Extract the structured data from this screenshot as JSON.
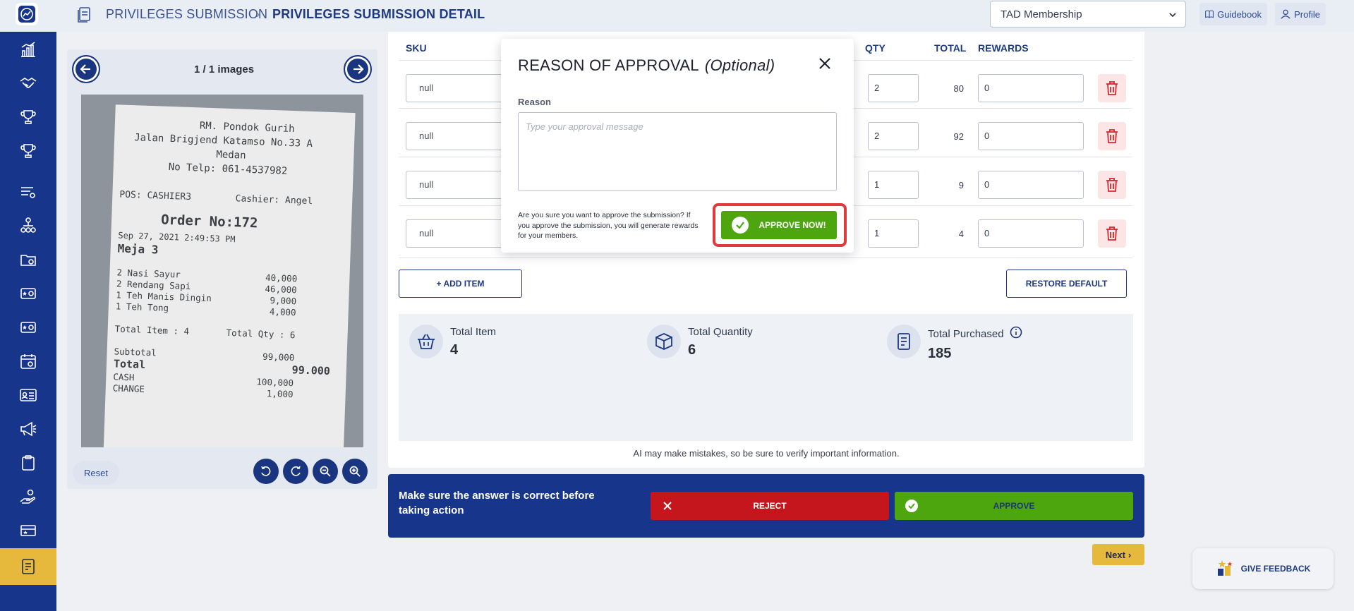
{
  "header": {
    "breadcrumb_parent": "PRIVILEGES SUBMISSION",
    "breadcrumb_current": "PRIVILEGES SUBMISSION DETAIL",
    "program_select_value": "TAD Membership",
    "guidebook_label": "Guidebook",
    "profile_label": "Profile"
  },
  "sidebar": {
    "icons": [
      "chart-icon",
      "handshake-icon",
      "trophy-icon",
      "trophy-icon",
      "list-filter-icon",
      "org-chart-icon",
      "folder-icon",
      "star-card-icon",
      "star-card-icon",
      "calendar-icon",
      "id-card-icon",
      "megaphone-icon",
      "clipboard-icon",
      "hand-coin-icon",
      "ticket-icon",
      "document-icon"
    ],
    "active_index": 15
  },
  "viewer": {
    "image_counter": "1 / 1 images",
    "reset_label": "Reset",
    "receipt_lines": [
      "RM. Pondok Gurih",
      "Jalan Brigjend Katamso No.33 A",
      "Medan",
      "No Telp: 061-4537982",
      "POS: CASHIER3        Cashier: Angel",
      "Order No:172",
      "Sep 27, 2021 2:49:53 PM",
      "Meja 3",
      "2 Nasi Sayur                40,000",
      "2 Rendang Sapi              46,000",
      "1 Teh Manis Dingin           9,000",
      "1 Teh Tong                   4,000",
      "Total Item : 4       Total Qty : 6",
      "Subtotal                    99,000",
      "Total                       99.000",
      "CASH                       100,000",
      "CHANGE                       1,000"
    ]
  },
  "table": {
    "headers": {
      "sku": "SKU",
      "qty": "QTY",
      "total": "TOTAL",
      "rewards": "REWARDS"
    },
    "rows": [
      {
        "sku": "null",
        "qty": "2",
        "total": "80",
        "reward": "0"
      },
      {
        "sku": "null",
        "qty": "2",
        "total": "92",
        "reward": "0"
      },
      {
        "sku": "null",
        "qty": "1",
        "total": "9",
        "reward": "0"
      },
      {
        "sku": "null",
        "qty": "1",
        "total": "4",
        "reward": "0"
      }
    ],
    "add_item_label": "+ ADD ITEM",
    "restore_default_label": "RESTORE DEFAULT"
  },
  "summary": {
    "total_item_label": "Total Item",
    "total_item_value": "4",
    "total_quantity_label": "Total Quantity",
    "total_quantity_value": "6",
    "total_purchased_label": "Total Purchased",
    "total_purchased_value": "185"
  },
  "ai_note": "AI may make mistakes, so be sure to verify important information.",
  "action_bar": {
    "message": "Make sure the answer is correct before taking action",
    "reject_label": "REJECT",
    "approve_label": "APPROVE"
  },
  "next_label": "Next",
  "feedback_label": "GIVE FEEDBACK",
  "modal": {
    "title": "REASON OF APPROVAL",
    "title_optional": "(Optional)",
    "reason_label": "Reason",
    "reason_placeholder": "Type your approval message",
    "reason_value": "",
    "confirm_text": "Are you sure you want to approve the submission? If you approve the submission, you will generate rewards for your members.",
    "approve_now_label": "APPROVE NOW!"
  },
  "colors": {
    "brand_navy": "#17358a",
    "accent_yellow": "#e6b83b",
    "approve_green": "#4ea60f",
    "reject_red": "#c4161c",
    "highlight_red": "#e0393e"
  }
}
